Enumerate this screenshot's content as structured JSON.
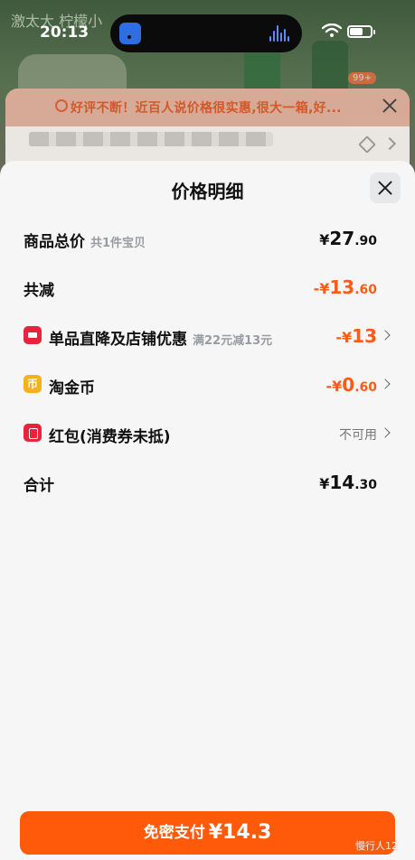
{
  "status_bar": {
    "time": "20:13"
  },
  "background": {
    "shop_name": "激太大   柠檬小",
    "badge": "99+"
  },
  "tip_banner": {
    "text": "好评不断！近百人说价格很实惠,很大一箱,好..."
  },
  "sheet": {
    "title": "价格明细",
    "rows": [
      {
        "label": "商品总价",
        "sub": "共1件宝贝",
        "currency": "¥",
        "int": "27",
        "dec": ".90"
      },
      {
        "label": "共减",
        "currency": "-¥",
        "int": "13",
        "dec": ".60"
      },
      {
        "label": "单品直降及店铺优惠",
        "sub": "满22元减13元",
        "currency": "-¥",
        "int": "13",
        "dec": ""
      },
      {
        "label": "淘金币",
        "icon_text": "币",
        "currency": "-¥",
        "int": "0",
        "dec": ".60"
      },
      {
        "label": "红包(消费券未抵)",
        "status": "不可用"
      },
      {
        "label": "合计",
        "currency": "¥",
        "int": "14",
        "dec": ".30"
      }
    ]
  },
  "pay_button": {
    "label": "免密支付",
    "amount": "¥14.3"
  },
  "watermark": "慢行人12",
  "colors": {
    "accent": "#ff5a0a",
    "discount": "#ff5a16",
    "sheet_bg": "#f6f6f7"
  }
}
